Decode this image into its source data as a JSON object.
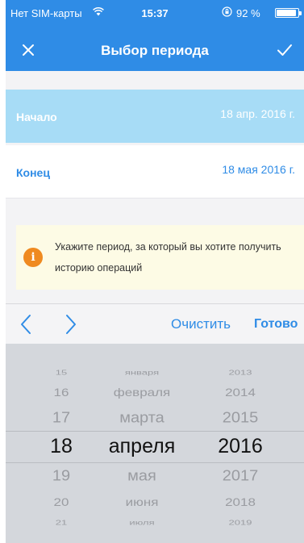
{
  "status_bar": {
    "carrier": "Нет SIM-карты",
    "time": "15:37",
    "battery_percent": "92 %",
    "battery_level": 0.92
  },
  "navbar": {
    "title": "Выбор периода",
    "close_icon": "close-icon",
    "done_icon": "checkmark-icon"
  },
  "period": {
    "start_label": "Начало",
    "start_value": "18 апр. 2016 г.",
    "end_label": "Конец",
    "end_value": "18 мая 2016 г."
  },
  "info": {
    "icon": "info-icon",
    "line1": "Укажите период, за который вы хотите получить",
    "line2": "историю операций"
  },
  "toolbar": {
    "prev_icon": "chevron-left-icon",
    "next_icon": "chevron-right-icon",
    "clear_label": "Очистить",
    "done_label": "Готово"
  },
  "picker": {
    "rows": [
      {
        "day": "15",
        "month": "января",
        "year": "2013"
      },
      {
        "day": "16",
        "month": "февраля",
        "year": "2014"
      },
      {
        "day": "17",
        "month": "марта",
        "year": "2015"
      },
      {
        "day": "18",
        "month": "апреля",
        "year": "2016"
      },
      {
        "day": "19",
        "month": "мая",
        "year": "2017"
      },
      {
        "day": "20",
        "month": "июня",
        "year": "2018"
      },
      {
        "day": "21",
        "month": "июля",
        "year": "2019"
      }
    ],
    "selected_index": 3
  },
  "colors": {
    "accent": "#2f8ce6",
    "selected_row": "#a7dcf6",
    "info_bg": "#fdfbe5",
    "info_icon": "#ef8a20"
  }
}
